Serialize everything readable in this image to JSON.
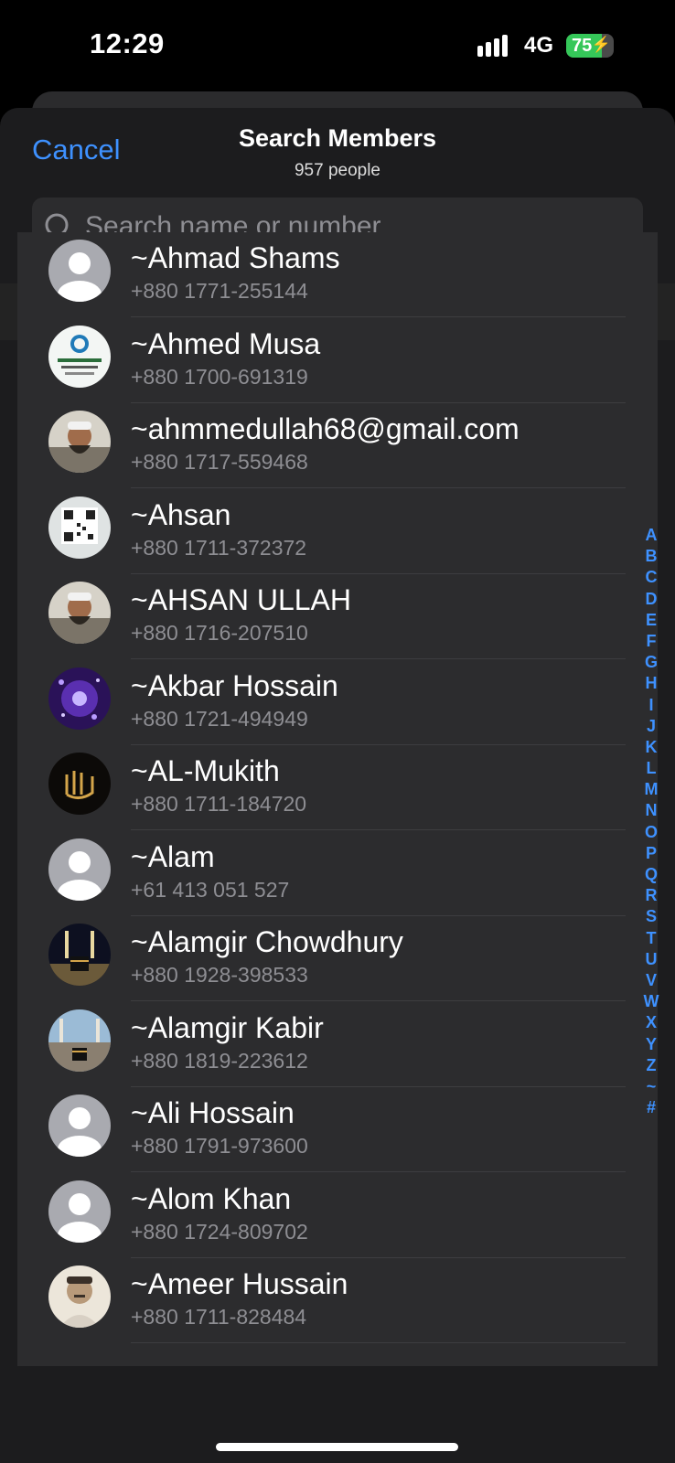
{
  "status_bar": {
    "time": "12:29",
    "network": "4G",
    "battery_level": "75",
    "signal_icon": "signal-bars-icon",
    "battery_icon": "battery-charging-icon"
  },
  "header": {
    "cancel_label": "Cancel",
    "title": "Search Members",
    "subtitle": "957 people"
  },
  "search": {
    "placeholder": "Search name or number",
    "value": "",
    "icon": "search-icon"
  },
  "section": {
    "label": "~"
  },
  "members": [
    {
      "name": "~Ahmad Shams",
      "phone": "+880 1771-255144",
      "avatar": "default-person-icon"
    },
    {
      "name": "~Ahmed Musa",
      "phone": "+880 1700-691319",
      "avatar": "logo-photo"
    },
    {
      "name": "~ahmmedullah68@gmail.com",
      "phone": "+880 1717-559468",
      "avatar": "person-photo"
    },
    {
      "name": "~Ahsan",
      "phone": "+880 1711-372372",
      "avatar": "qr-code-photo"
    },
    {
      "name": "~AHSAN ULLAH",
      "phone": "+880 1716-207510",
      "avatar": "person-photo"
    },
    {
      "name": "~Akbar Hossain",
      "phone": "+880 1721-494949",
      "avatar": "purple-flower-photo"
    },
    {
      "name": "~AL-Mukith",
      "phone": "+880 1711-184720",
      "avatar": "calligraphy-photo"
    },
    {
      "name": "~Alam",
      "phone": "+61 413 051 527",
      "avatar": "default-person-icon"
    },
    {
      "name": "~Alamgir Chowdhury",
      "phone": "+880 1928-398533",
      "avatar": "kaaba-night-photo"
    },
    {
      "name": "~Alamgir Kabir",
      "phone": "+880 1819-223612",
      "avatar": "kaaba-day-photo"
    },
    {
      "name": "~Ali Hossain",
      "phone": "+880 1791-973600",
      "avatar": "default-person-icon"
    },
    {
      "name": "~Alom Khan",
      "phone": "+880 1724-809702",
      "avatar": "default-person-icon"
    },
    {
      "name": "~Ameer Hussain",
      "phone": "+880 1711-828484",
      "avatar": "portrait-photo"
    }
  ],
  "index_letters": [
    "A",
    "B",
    "C",
    "D",
    "E",
    "F",
    "G",
    "H",
    "I",
    "J",
    "K",
    "L",
    "M",
    "N",
    "O",
    "P",
    "Q",
    "R",
    "S",
    "T",
    "U",
    "V",
    "W",
    "X",
    "Y",
    "Z",
    "~",
    "#"
  ],
  "colors": {
    "accent": "#3e91ff",
    "battery": "#35c759",
    "sheet": "#1c1c1e",
    "row": "#2c2c2e"
  }
}
